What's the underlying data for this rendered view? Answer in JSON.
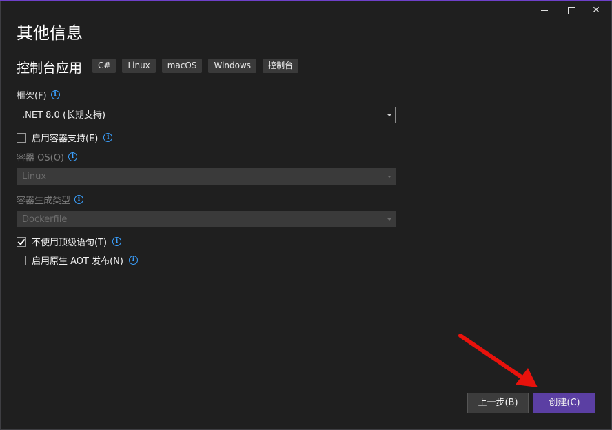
{
  "window": {
    "controls": {
      "minimize_icon": "minimize-icon",
      "maximize_icon": "maximize-icon",
      "close_glyph": "✕"
    }
  },
  "page": {
    "title": "其他信息"
  },
  "template": {
    "name": "控制台应用",
    "tags": [
      "C#",
      "Linux",
      "macOS",
      "Windows",
      "控制台"
    ]
  },
  "framework": {
    "label": "框架(F)",
    "value": ".NET 8.0 (长期支持)"
  },
  "container_support": {
    "label": "启用容器支持(E)",
    "checked": false
  },
  "container_os": {
    "label": "容器 OS(O)",
    "value": "Linux",
    "disabled": true
  },
  "container_build_type": {
    "label": "容器生成类型",
    "value": "Dockerfile",
    "disabled": true
  },
  "top_level_statements": {
    "label": "不使用顶级语句(T)",
    "checked": true
  },
  "native_aot": {
    "label": "启用原生 AOT 发布(N)",
    "checked": false
  },
  "footer": {
    "back_label": "上一步(B)",
    "create_label": "创建(C)"
  },
  "colors": {
    "accent": "#5b3fa3",
    "info_icon": "#3aa0ff",
    "annotation_arrow": "#e8120c"
  }
}
